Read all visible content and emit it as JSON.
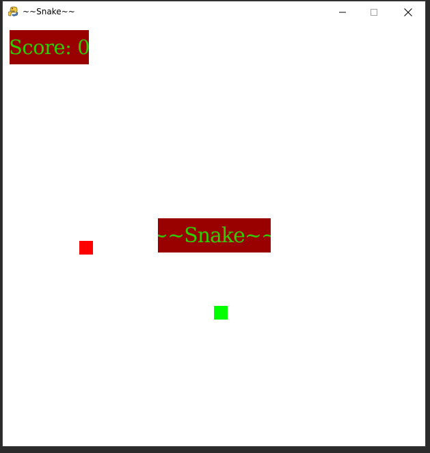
{
  "window": {
    "title": "~~Snake~~"
  },
  "game": {
    "score_label": "Score: 0",
    "title_label": "~~Snake~~",
    "colors": {
      "label_background": "#990000",
      "label_text": "#33cc00",
      "food": "#ff0000",
      "snake": "#00ff00",
      "board_background": "#ffffff"
    },
    "food": {
      "icon": "food-square",
      "color": "#ff0000"
    },
    "snake": {
      "icon": "snake-segment",
      "color": "#00ff00"
    }
  }
}
